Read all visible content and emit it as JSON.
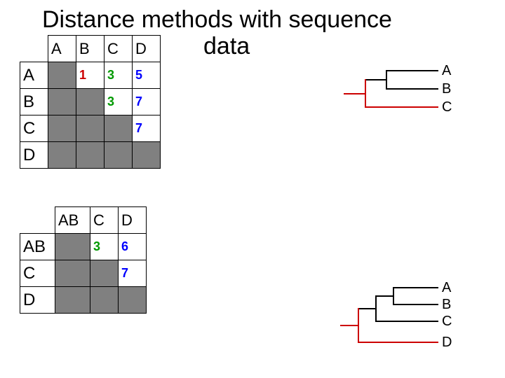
{
  "title_line1": "Distance methods with sequence",
  "title_line2": "data",
  "matrix1": {
    "col_headers": [
      "A",
      "B",
      "C",
      "D"
    ],
    "row_headers": [
      "A",
      "B",
      "C",
      "D"
    ],
    "cells": {
      "A_B": {
        "value": "1",
        "color": "red"
      },
      "A_C": {
        "value": "3",
        "color": "green"
      },
      "A_D": {
        "value": "5",
        "color": "blue"
      },
      "B_C": {
        "value": "3",
        "color": "green"
      },
      "B_D": {
        "value": "7",
        "color": "blue"
      },
      "C_D": {
        "value": "7",
        "color": "blue"
      }
    }
  },
  "matrix2": {
    "col_headers": [
      "AB",
      "C",
      "D"
    ],
    "row_headers": [
      "AB",
      "C",
      "D"
    ],
    "cells": {
      "AB_C": {
        "value": "3",
        "color": "green"
      },
      "AB_D": {
        "value": "6",
        "color": "blue"
      },
      "C_D": {
        "value": "7",
        "color": "blue"
      }
    }
  },
  "tree1": {
    "tips": [
      "A",
      "B",
      "C"
    ]
  },
  "tree2": {
    "tips": [
      "A",
      "B",
      "C",
      "D"
    ]
  }
}
